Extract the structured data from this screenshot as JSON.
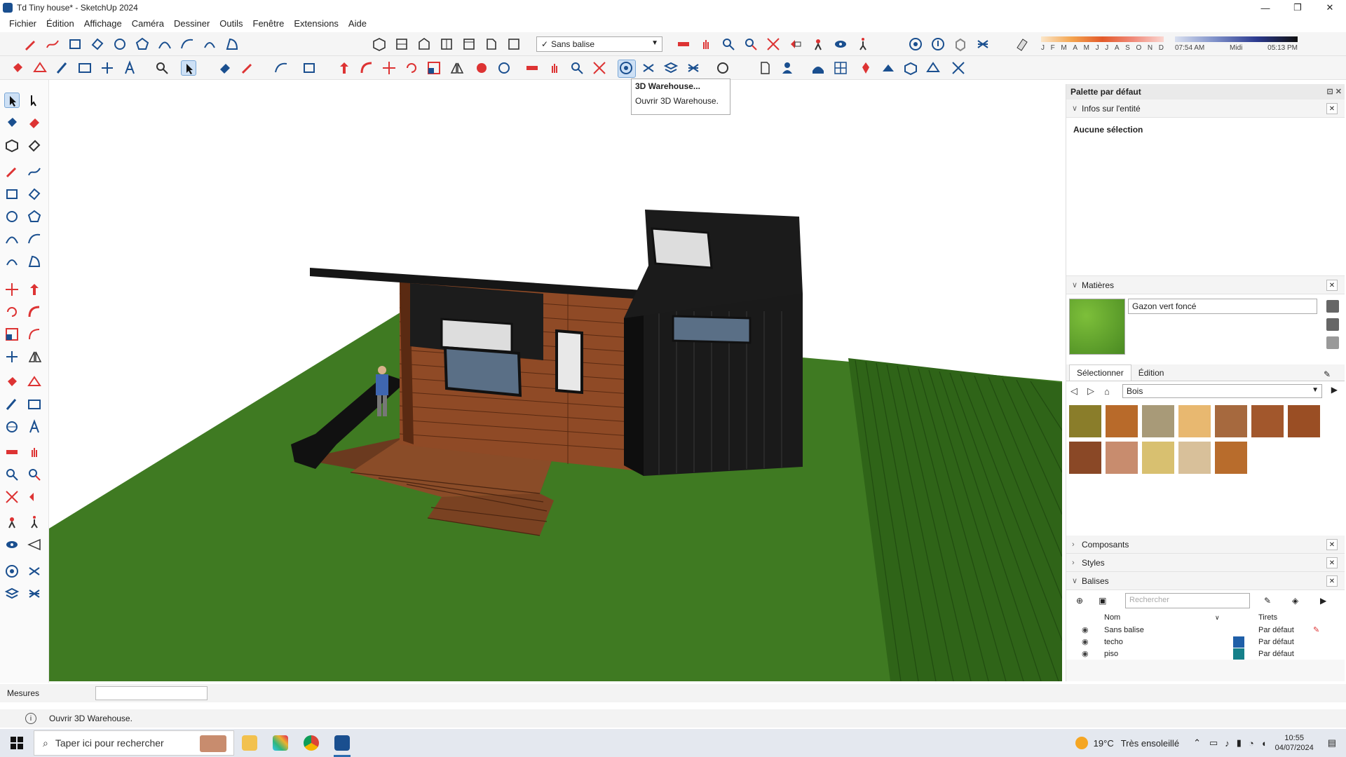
{
  "window": {
    "title": "Td Tiny house* - SketchUp 2024",
    "minimize": "—",
    "maximize": "❐",
    "close": "✕"
  },
  "menu": [
    "Fichier",
    "Édition",
    "Affichage",
    "Caméra",
    "Dessiner",
    "Outils",
    "Fenêtre",
    "Extensions",
    "Aide"
  ],
  "toolbar": {
    "tag_select": "Sans balise",
    "tag_check": "✓",
    "months": [
      "J",
      "F",
      "M",
      "A",
      "M",
      "J",
      "J",
      "A",
      "S",
      "O",
      "N",
      "D"
    ],
    "time_labels": [
      "07:54 AM",
      "Midi",
      "05:13 PM"
    ]
  },
  "tooltip": {
    "title": "3D Warehouse...",
    "desc": "Ouvrir 3D Warehouse."
  },
  "panel": {
    "title": "Palette par défaut",
    "entity": {
      "title": "Infos sur l'entité",
      "body": "Aucune sélection"
    },
    "materials": {
      "title": "Matières",
      "current": "Gazon vert foncé",
      "tabs": [
        "Sélectionner",
        "Édition"
      ],
      "library": "Bois",
      "swatches": [
        "#8a7d2a",
        "#b86a2a",
        "#a89a78",
        "#e8b870",
        "#a6693e",
        "#a2572c",
        "#9a4e24",
        "#8a4826",
        "#c88c6e",
        "#d8c070",
        "#d8c09a",
        "#b86c2c"
      ]
    },
    "components": "Composants",
    "styles": "Styles",
    "tags": {
      "title": "Balises",
      "search_placeholder": "Rechercher",
      "col_name": "Nom",
      "col_dash": "Tirets",
      "rows": [
        {
          "name": "Sans balise",
          "dash": "Par défaut",
          "color": "#ffffff"
        },
        {
          "name": "techo",
          "dash": "Par défaut",
          "color": "#1f5fa8"
        },
        {
          "name": "piso",
          "dash": "Par défaut",
          "color": "#15808a"
        }
      ]
    }
  },
  "status": {
    "measures_label": "Mesures",
    "hint": "Ouvrir 3D Warehouse."
  },
  "taskbar": {
    "search": "Taper ici pour rechercher",
    "weather_temp": "19°C",
    "weather_text": "Très ensoleillé",
    "time": "10:55",
    "date": "04/07/2024"
  }
}
